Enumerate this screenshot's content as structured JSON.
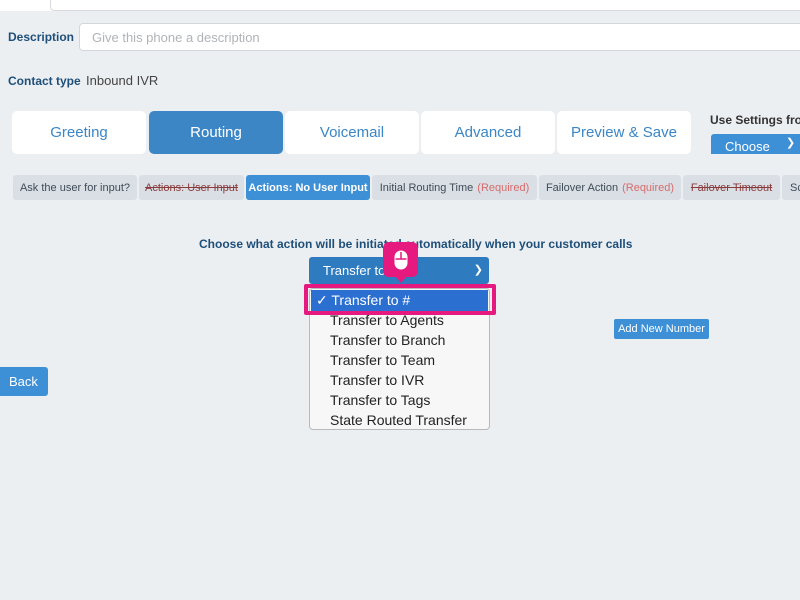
{
  "form": {
    "description_label": "Description",
    "description_placeholder": "Give this phone a description",
    "description_value": "",
    "contact_type_label": "Contact type",
    "contact_type_value": "Inbound IVR"
  },
  "tabs": [
    {
      "label": "Greeting",
      "active": false
    },
    {
      "label": "Routing",
      "active": true
    },
    {
      "label": "Voicemail",
      "active": false
    },
    {
      "label": "Advanced",
      "active": false
    },
    {
      "label": "Preview & Save",
      "active": false
    }
  ],
  "use_settings": {
    "label": "Use Settings from",
    "button": "Choose"
  },
  "subtabs": [
    {
      "label": "Ask the user for input?",
      "required": "",
      "strike": false,
      "active": false
    },
    {
      "label": "Actions: User Input",
      "required": "",
      "strike": true,
      "active": false
    },
    {
      "label": "Actions: No User Input",
      "required": "",
      "strike": false,
      "active": true
    },
    {
      "label": "Initial Routing Time",
      "required": "(Required)",
      "strike": false,
      "active": false
    },
    {
      "label": "Failover Action",
      "required": "(Required)",
      "strike": false,
      "active": false
    },
    {
      "label": "Failover Timeout",
      "required": "",
      "strike": true,
      "active": false
    },
    {
      "label": "Sc",
      "required": "",
      "strike": false,
      "active": false
    }
  ],
  "routing": {
    "prompt": "Choose what action will be initiated automatically when your customer calls",
    "select_value": "Transfer to #",
    "options": [
      "Transfer to #",
      "Transfer to Agents",
      "Transfer to Branch",
      "Transfer to Team",
      "Transfer to IVR",
      "Transfer to Tags",
      "State Routed Transfer"
    ],
    "selected_index": 0,
    "add_number_label": "Add New Number"
  },
  "nav": {
    "back_label": "Back"
  },
  "colors": {
    "accent": "#3d8fd6",
    "active_tab": "#3d86c6",
    "highlight": "#e6197e",
    "option_selected": "#2b6fd1",
    "label_blue": "#1e4f79"
  },
  "icons": {
    "cursor": "mouse-icon",
    "chevron": "chevron-down-icon",
    "check": "checkmark-icon"
  }
}
